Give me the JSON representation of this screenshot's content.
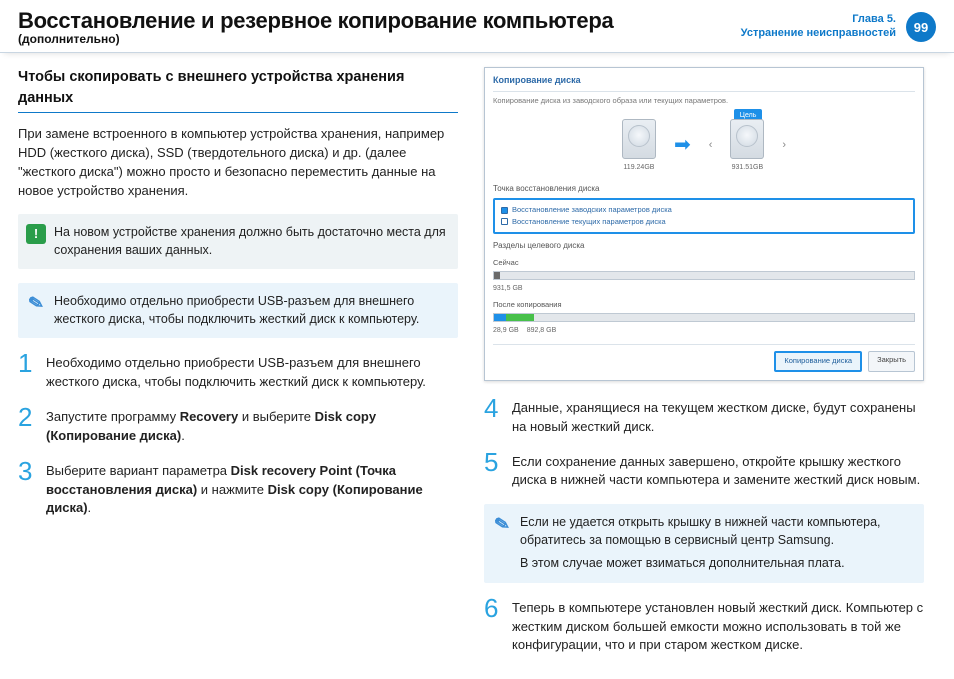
{
  "header": {
    "title": "Восстановление и резервное копирование компьютера",
    "subtitle": "(дополнительно)",
    "chapter_line1": "Глава 5.",
    "chapter_line2": "Устранение неисправностей",
    "page_number": "99"
  },
  "left": {
    "section_title": "Чтобы скопировать с внешнего устройства хранения данных",
    "intro": "При замене встроенного в компьютер устройства хранения, например HDD (жесткого диска), SSD (твердотельного диска) и др. (далее \"жесткого диска\") можно просто и безопасно переместить данные на новое устройство хранения.",
    "warn_box": "На новом устройстве хранения должно быть достаточно места для сохранения ваших данных.",
    "info_box": "Необходимо отдельно приобрести USB-разъем для внешнего жесткого диска, чтобы подключить жесткий диск к компьютеру.",
    "steps": {
      "1": "Необходимо отдельно приобрести USB-разъем для внешнего жесткого диска, чтобы подключить жесткий диск к компьютеру.",
      "2_pre": "Запустите программу ",
      "2_b1": "Recovery",
      "2_mid": " и выберите ",
      "2_b2": "Disk copy (Копирование диска)",
      "2_post": ".",
      "3_pre": "Выберите вариант параметра ",
      "3_b1": "Disk recovery Point (Точка восстановления диска)",
      "3_mid": " и нажмите ",
      "3_b2": "Disk copy (Копирование диска)",
      "3_post": "."
    }
  },
  "right": {
    "steps": {
      "4": "Данные, хранящиеся на текущем жестком диске, будут сохранены на новый жесткий диск.",
      "5": "Если сохранение данных завершено, откройте крышку жесткого диска в нижней части компьютера и замените жесткий диск новым.",
      "6": "Теперь в компьютере установлен новый жесткий диск. Компьютер с жестким диском большей емкости можно использовать в той же конфигурации, что и при старом жестком диске."
    },
    "note_line1": "Если не удается открыть крышку в нижней части компьютера, обратитесь за помощью в сервисный центр Samsung.",
    "note_line2": "В этом случае может взиматься дополнительная плата."
  },
  "screenshot": {
    "window_title": "Копирование диска",
    "subtitle": "Копирование диска из заводского образа или текущих параметров.",
    "target_tag": "Цель",
    "src_size": "119.24GB",
    "dst_size": "931.51GB",
    "sec1_label": "Точка восстановления диска",
    "radio1": "Восстановление заводских параметров диска",
    "radio2": "Восстановление текущих параметров диска",
    "sec2_label": "Разделы целевого диска",
    "part1_label": "Сейчас",
    "part1_cap": "931,5 GB",
    "part2_label": "После копирования",
    "part2_cap1": "28,9 GB",
    "part2_cap2": "892,8 GB",
    "btn_primary": "Копирование диска",
    "btn_close": "Закрыть"
  }
}
